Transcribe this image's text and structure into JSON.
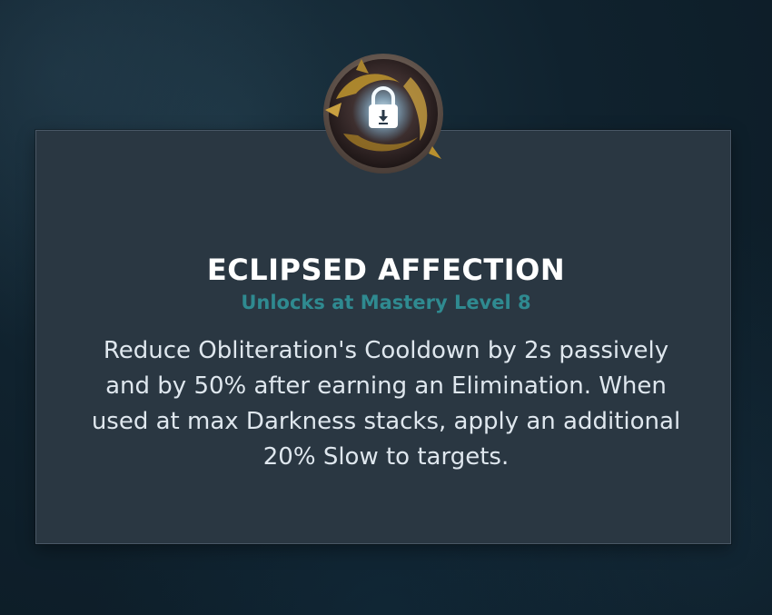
{
  "talent": {
    "name": "ECLIPSED AFFECTION",
    "unlock_text": "Unlocks at Mastery Level 8",
    "description": "Reduce Obliteration's Cooldown by 2s passively and by 50% after earning an Elimination. When used at max Darkness stacks, apply an additional 20% Slow to targets.",
    "icon": "locked-talent-emblem-icon",
    "lock_icon": "padlock-icon"
  },
  "colors": {
    "card_background": "#2a3742",
    "title": "#ffffff",
    "unlock_text": "#2f8a90",
    "description": "#dfe7ee",
    "lock_glow": "#bfe9ff",
    "emblem_gold": "#b8902e"
  }
}
